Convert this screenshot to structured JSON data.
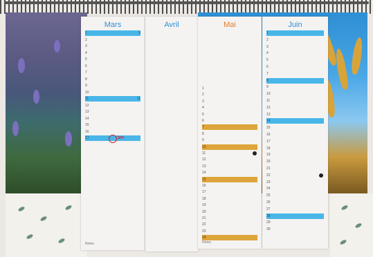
{
  "pages": {
    "mars": {
      "month": "Mars",
      "month_color": "#2e8fd8"
    },
    "avril": {
      "month": "Avril",
      "month_color": "#2e8fd8"
    },
    "mai": {
      "month": "Mai",
      "month_color": "#e07a2a"
    },
    "juin": {
      "month": "Juin",
      "month_color": "#2e8fd8"
    }
  },
  "mars_rows": [
    {
      "n": "1",
      "d": "",
      "w": "9"
    },
    {
      "n": "2",
      "d": "",
      "w": ""
    },
    {
      "n": "3",
      "d": "",
      "w": ""
    },
    {
      "n": "4",
      "d": "",
      "w": ""
    },
    {
      "n": "5",
      "d": "",
      "w": ""
    },
    {
      "n": "6",
      "d": "",
      "w": ""
    },
    {
      "n": "7",
      "d": "",
      "w": ""
    },
    {
      "n": "8",
      "d": "",
      "w": ""
    },
    {
      "n": "9",
      "d": "",
      "w": ""
    },
    {
      "n": "10",
      "d": "",
      "w": ""
    },
    {
      "n": "11",
      "d": "",
      "w": "11"
    },
    {
      "n": "12",
      "d": "",
      "w": ""
    },
    {
      "n": "13",
      "d": "",
      "w": ""
    },
    {
      "n": "14",
      "d": "",
      "w": ""
    },
    {
      "n": "15",
      "d": "",
      "w": ""
    },
    {
      "n": "16",
      "d": "",
      "w": ""
    },
    {
      "n": "17",
      "d": "",
      "w": ""
    }
  ],
  "mai_rows": [
    {
      "n": "1",
      "d": "",
      "w": ""
    },
    {
      "n": "2",
      "d": "",
      "w": ""
    },
    {
      "n": "3",
      "d": "",
      "w": ""
    },
    {
      "n": "4",
      "d": "",
      "w": ""
    },
    {
      "n": "5",
      "d": "",
      "w": ""
    },
    {
      "n": "6",
      "d": "",
      "w": ""
    },
    {
      "n": "7",
      "d": "",
      "w": ""
    },
    {
      "n": "8",
      "d": "",
      "w": ""
    },
    {
      "n": "9",
      "d": "",
      "w": ""
    },
    {
      "n": "10",
      "d": "",
      "w": ""
    },
    {
      "n": "11",
      "d": "",
      "w": ""
    },
    {
      "n": "12",
      "d": "",
      "w": ""
    },
    {
      "n": "13",
      "d": "",
      "w": ""
    },
    {
      "n": "14",
      "d": "",
      "w": ""
    },
    {
      "n": "15",
      "d": "",
      "w": ""
    },
    {
      "n": "16",
      "d": "",
      "w": ""
    },
    {
      "n": "17",
      "d": "",
      "w": ""
    },
    {
      "n": "18",
      "d": "",
      "w": ""
    },
    {
      "n": "19",
      "d": "",
      "w": ""
    },
    {
      "n": "20",
      "d": "",
      "w": ""
    },
    {
      "n": "21",
      "d": "",
      "w": ""
    },
    {
      "n": "22",
      "d": "",
      "w": ""
    },
    {
      "n": "23",
      "d": "",
      "w": ""
    },
    {
      "n": "24",
      "d": "",
      "w": ""
    }
  ],
  "juin_rows": [
    {
      "n": "1",
      "d": "",
      "w": ""
    },
    {
      "n": "2",
      "d": "",
      "w": ""
    },
    {
      "n": "3",
      "d": "",
      "w": ""
    },
    {
      "n": "4",
      "d": "",
      "w": ""
    },
    {
      "n": "5",
      "d": "",
      "w": ""
    },
    {
      "n": "6",
      "d": "",
      "w": ""
    },
    {
      "n": "7",
      "d": "",
      "w": ""
    },
    {
      "n": "8",
      "d": "",
      "w": ""
    },
    {
      "n": "9",
      "d": "",
      "w": ""
    },
    {
      "n": "10",
      "d": "",
      "w": ""
    },
    {
      "n": "11",
      "d": "",
      "w": ""
    },
    {
      "n": "12",
      "d": "",
      "w": ""
    },
    {
      "n": "13",
      "d": "",
      "w": ""
    },
    {
      "n": "14",
      "d": "",
      "w": ""
    },
    {
      "n": "15",
      "d": "",
      "w": ""
    },
    {
      "n": "16",
      "d": "",
      "w": ""
    },
    {
      "n": "17",
      "d": "",
      "w": ""
    },
    {
      "n": "18",
      "d": "",
      "w": ""
    },
    {
      "n": "19",
      "d": "",
      "w": ""
    },
    {
      "n": "20",
      "d": "",
      "w": ""
    },
    {
      "n": "21",
      "d": "",
      "w": ""
    },
    {
      "n": "22",
      "d": "",
      "w": ""
    },
    {
      "n": "23",
      "d": "",
      "w": ""
    },
    {
      "n": "24",
      "d": "",
      "w": ""
    },
    {
      "n": "25",
      "d": "",
      "w": ""
    },
    {
      "n": "26",
      "d": "",
      "w": ""
    },
    {
      "n": "27",
      "d": "",
      "w": ""
    },
    {
      "n": "28",
      "d": "",
      "w": ""
    },
    {
      "n": "29",
      "d": "",
      "w": ""
    },
    {
      "n": "30",
      "d": "",
      "w": ""
    }
  ],
  "footer_note": "Notes",
  "logo_text": "SFF"
}
